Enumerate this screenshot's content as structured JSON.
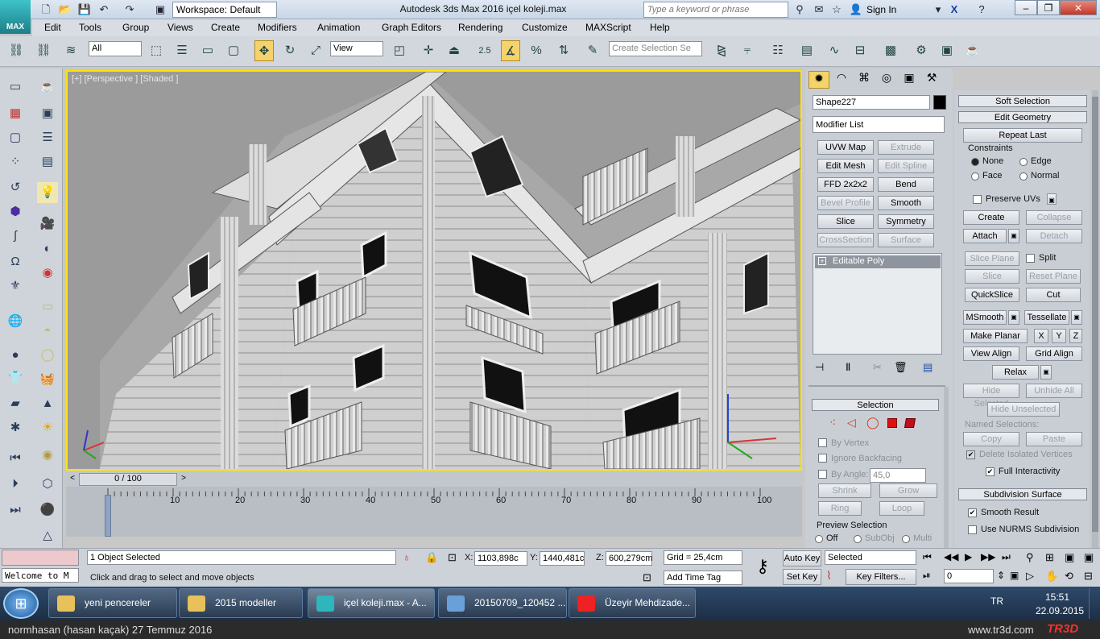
{
  "app": {
    "logo_label": "MAX",
    "workspace": "Workspace: Default",
    "title": "Autodesk 3ds Max 2016     içel koleji.max",
    "search_placeholder": "Type a keyword or phrase",
    "sign_in": "Sign In"
  },
  "menu": [
    "Edit",
    "Tools",
    "Group",
    "Views",
    "Create",
    "Modifiers",
    "Animation",
    "Graph Editors",
    "Rendering",
    "Customize",
    "MAXScript",
    "Help"
  ],
  "toolbar": {
    "filter": "All",
    "ref_coord": "View",
    "snap_value": "2.5",
    "selection_set_placeholder": "Create Selection Se"
  },
  "viewport": {
    "label": "[+] [Perspective ] [Shaded ]"
  },
  "timeline": {
    "frame": "0 / 100",
    "ticks": [
      "0",
      "10",
      "20",
      "30",
      "40",
      "50",
      "60",
      "70",
      "80",
      "90",
      "100"
    ]
  },
  "command_panel": {
    "object_name": "Shape227",
    "modifier_list": "Modifier List",
    "modifier_buttons": [
      {
        "label": "UVW Map",
        "enabled": true
      },
      {
        "label": "Extrude",
        "enabled": false
      },
      {
        "label": "Edit Mesh",
        "enabled": true
      },
      {
        "label": "Edit Spline",
        "enabled": false
      },
      {
        "label": "FFD 2x2x2",
        "enabled": true
      },
      {
        "label": "Bend",
        "enabled": true
      },
      {
        "label": "Bevel Profile",
        "enabled": false
      },
      {
        "label": "Smooth",
        "enabled": true
      },
      {
        "label": "Slice",
        "enabled": true
      },
      {
        "label": "Symmetry",
        "enabled": true
      },
      {
        "label": "CrossSection",
        "enabled": false
      },
      {
        "label": "Surface",
        "enabled": false
      }
    ],
    "stack_item": "Editable Poly",
    "selection": {
      "title": "Selection",
      "by_vertex": "By Vertex",
      "ignore_backfacing": "Ignore Backfacing",
      "by_angle": "By Angle:",
      "angle_value": "45,0",
      "shrink": "Shrink",
      "grow": "Grow",
      "ring": "Ring",
      "loop": "Loop",
      "preview": "Preview Selection",
      "off": "Off",
      "subobj": "SubObj",
      "multi": "Multi"
    }
  },
  "rollout": {
    "soft_selection": "Soft Selection",
    "edit_geometry": "Edit Geometry",
    "repeat_last": "Repeat Last",
    "constraints": "Constraints",
    "none": "None",
    "edge": "Edge",
    "face": "Face",
    "normal": "Normal",
    "preserve_uvs": "Preserve UVs",
    "create": "Create",
    "collapse": "Collapse",
    "attach": "Attach",
    "detach": "Detach",
    "slice_plane": "Slice Plane",
    "split": "Split",
    "slice": "Slice",
    "reset_plane": "Reset Plane",
    "quickslice": "QuickSlice",
    "cut": "Cut",
    "msmooth": "MSmooth",
    "tessellate": "Tessellate",
    "make_planar": "Make Planar",
    "x": "X",
    "y": "Y",
    "z": "Z",
    "view_align": "View Align",
    "grid_align": "Grid Align",
    "relax": "Relax",
    "hide_selected": "Hide Selected",
    "unhide_all": "Unhide All",
    "hide_unselected": "Hide Unselected",
    "named_selections": "Named Selections:",
    "copy": "Copy",
    "paste": "Paste",
    "delete_isolated": "Delete Isolated Vertices",
    "full_interactivity": "Full Interactivity",
    "subdivision_surface": "Subdivision Surface",
    "smooth_result": "Smooth Result",
    "use_nurms": "Use NURMS Subdivision"
  },
  "status": {
    "welcome": "Welcome to M",
    "objects_selected": "1 Object Selected",
    "prompt": "Click and drag to select and move objects",
    "x_label": "X:",
    "x": "1103,898c",
    "y_label": "Y:",
    "y": "1440,481c",
    "z_label": "Z:",
    "z": "600,279cm",
    "grid": "Grid = 25,4cm",
    "add_time_tag": "Add Time Tag",
    "auto_key": "Auto Key",
    "set_key": "Set Key",
    "key_mode": "Selected",
    "key_filters": "Key Filters...",
    "frame_field": "0"
  },
  "taskbar": {
    "items": [
      "yeni pencereler",
      "2015 modeller",
      "içel koleji.max - A...",
      "20150709_120452 ...",
      "Üzeyir Mehdizade..."
    ],
    "lang": "TR",
    "time": "15:51",
    "date": "22.09.2015"
  },
  "footer": {
    "left": "normhasan (hasan kaçak)  27 Temmuz 2016",
    "right": "www.tr3d.com",
    "brand": "TR3D"
  }
}
